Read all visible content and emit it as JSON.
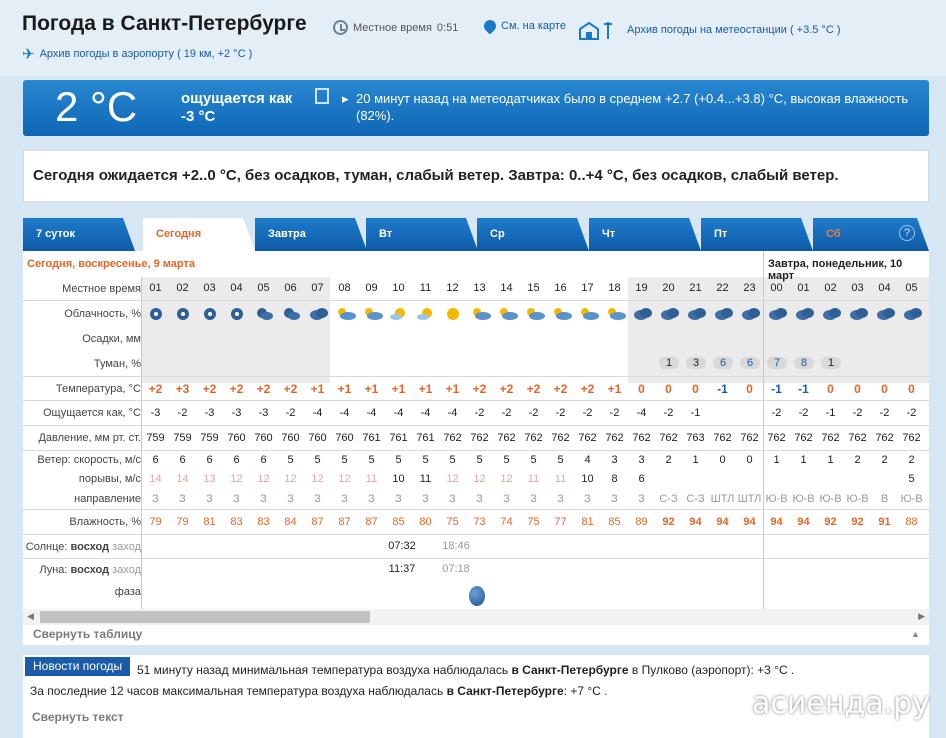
{
  "header": {
    "title": "Погода в Санкт-Петербурге",
    "local_time_label": "Местное время",
    "local_time": "0:51",
    "map_link": "См. на карте",
    "station_archive": "Архив погоды на метеостанции ( +3.5 °C )",
    "airport_archive": "Архив погоды в аэропорту ( 19 км, +2 °C )"
  },
  "current": {
    "temp": "2 °C",
    "feels_like": "ощущается как -3 °C",
    "message": "20 минут назад на метеодатчиках было в среднем +2.7 (+0.4...+3.8) °C, высокая влажность (82%)."
  },
  "forecast_text": "Сегодня ожидается +2..0 °C, без осадков, туман, слабый ветер. Завтра: 0..+4 °C, без осадков, слабый ветер.",
  "tabs": [
    {
      "label": "7 суток",
      "active": false
    },
    {
      "label": "Сегодня",
      "active": true
    },
    {
      "label": "Завтра",
      "active": false
    },
    {
      "label": "Вт",
      "active": false
    },
    {
      "label": "Ср",
      "active": false
    },
    {
      "label": "Чт",
      "active": false
    },
    {
      "label": "Пт",
      "active": false
    },
    {
      "label": "Сб",
      "active": false
    }
  ],
  "table": {
    "today_label": "Сегодня, воскресенье, 9 марта",
    "tomorrow_label": "Завтра, понедельник, 10 март",
    "row_labels": {
      "time": "Местное время",
      "cloud": "Облачность, %",
      "precip": "Осадки, мм",
      "fog": "Туман, %",
      "temp": "Температура, °C",
      "feels": "Ощущается как, °C",
      "pressure": "Давление, мм рт. ст.",
      "wind_speed": "Ветер: скорость, м/с",
      "gusts": "порывы, м/с",
      "direction": "направление",
      "humidity": "Влажность, %",
      "sun": "Солнце:",
      "sun_rise": "восход",
      "sun_set": "заход",
      "moon": "Луна:",
      "moon_rise": "восход",
      "moon_set": "заход",
      "phase": "фаза"
    },
    "hours": [
      "01",
      "02",
      "03",
      "04",
      "05",
      "06",
      "07",
      "08",
      "09",
      "10",
      "11",
      "12",
      "13",
      "14",
      "15",
      "16",
      "17",
      "18",
      "19",
      "20",
      "21",
      "22",
      "23",
      "00",
      "01",
      "02",
      "03",
      "04",
      "05"
    ],
    "cloud_icons": [
      "night-clear-icon",
      "night-clear-icon",
      "night-clear-icon",
      "night-clear-icon",
      "night-partly-cloudy-icon",
      "night-partly-cloudy-icon",
      "night-cloudy-icon",
      "partly-sunny-icon",
      "partly-sunny-icon",
      "sunny-cloud-icon",
      "sunny-cloud-icon",
      "sun-icon",
      "partly-sunny-icon",
      "partly-sunny-icon",
      "partly-sunny-icon",
      "partly-sunny-icon",
      "partly-sunny-icon",
      "partly-sunny-icon",
      "night-cloudy-icon",
      "night-cloudy-icon",
      "night-cloudy-icon",
      "night-cloudy-icon",
      "night-cloudy-icon",
      "night-cloudy-icon",
      "night-cloudy-icon",
      "night-cloudy-icon",
      "night-cloudy-icon",
      "night-cloudy-icon",
      "night-cloudy-icon"
    ],
    "fog": [
      "",
      "",
      "",
      "",
      "",
      "",
      "",
      "",
      "",
      "",
      "",
      "",
      "",
      "",
      "",
      "",
      "",
      "",
      "",
      "1",
      "3",
      "6",
      "6",
      "7",
      "8",
      "1",
      "",
      "",
      ""
    ],
    "temp": [
      "+2",
      "+3",
      "+2",
      "+2",
      "+2",
      "+2",
      "+1",
      "+1",
      "+1",
      "+1",
      "+1",
      "+1",
      "+2",
      "+2",
      "+2",
      "+2",
      "+2",
      "+1",
      "0",
      "0",
      "0",
      "-1",
      "0",
      "-1",
      "-1",
      "0",
      "0",
      "0",
      "0"
    ],
    "feels": [
      "-3",
      "-2",
      "-3",
      "-3",
      "-3",
      "-2",
      "-4",
      "-4",
      "-4",
      "-4",
      "-4",
      "-4",
      "-2",
      "-2",
      "-2",
      "-2",
      "-2",
      "-2",
      "-4",
      "-2",
      "-1",
      "",
      "",
      "-2",
      "-2",
      "-1",
      "-2",
      "-2",
      "-2"
    ],
    "pressure": [
      "759",
      "759",
      "759",
      "760",
      "760",
      "760",
      "760",
      "760",
      "761",
      "761",
      "761",
      "762",
      "762",
      "762",
      "762",
      "762",
      "762",
      "762",
      "762",
      "762",
      "763",
      "762",
      "762",
      "762",
      "762",
      "762",
      "762",
      "762",
      "762"
    ],
    "wind_speed": [
      "6",
      "6",
      "6",
      "6",
      "6",
      "5",
      "5",
      "5",
      "5",
      "5",
      "5",
      "5",
      "5",
      "5",
      "5",
      "5",
      "4",
      "3",
      "3",
      "2",
      "1",
      "0",
      "0",
      "1",
      "1",
      "1",
      "2",
      "2",
      "2"
    ],
    "gusts": [
      "14",
      "14",
      "13",
      "12",
      "12",
      "12",
      "12",
      "12",
      "11",
      "10",
      "11",
      "12",
      "12",
      "12",
      "11",
      "11",
      "10",
      "8",
      "6",
      "",
      "",
      "",
      "",
      "",
      "",
      "",
      "",
      "",
      "5"
    ],
    "direction": [
      "З",
      "З",
      "З",
      "З",
      "З",
      "З",
      "З",
      "З",
      "З",
      "З",
      "З",
      "З",
      "З",
      "З",
      "З",
      "З",
      "З",
      "З",
      "З",
      "С-З",
      "С-З",
      "ШТЛ",
      "ШТЛ",
      "Ю-В",
      "Ю-В",
      "Ю-В",
      "Ю-В",
      "В",
      "Ю-В"
    ],
    "humidity": [
      "79",
      "79",
      "81",
      "83",
      "83",
      "84",
      "87",
      "87",
      "87",
      "85",
      "80",
      "75",
      "73",
      "74",
      "75",
      "77",
      "81",
      "85",
      "89",
      "92",
      "94",
      "94",
      "94",
      "94",
      "94",
      "92",
      "92",
      "91",
      "88"
    ],
    "sunrise": "07:32",
    "sunset": "18:46",
    "moonrise": "11:37",
    "moonset": "07:18"
  },
  "collapse_table": "Свернуть таблицу",
  "news": {
    "badge": "Новости погоды",
    "line1_pre": "51 минуту назад минимальная температура воздуха наблюдалась",
    "line1_city": "в Санкт-Петербурге",
    "line1_post": "в Пулково (аэропорт): +3 °C .",
    "line2_pre": "За последние 12 часов максимальная температура воздуха наблюдалась",
    "line2_city": "в Санкт-Петербурге",
    "line2_post": ": +7 °C .",
    "collapse": "Свернуть текст"
  },
  "watermark": "асиенда.ру",
  "colors": {
    "accent": "#1a5ca8",
    "warm": "#e2662a",
    "banner": "#1a7ac7"
  }
}
